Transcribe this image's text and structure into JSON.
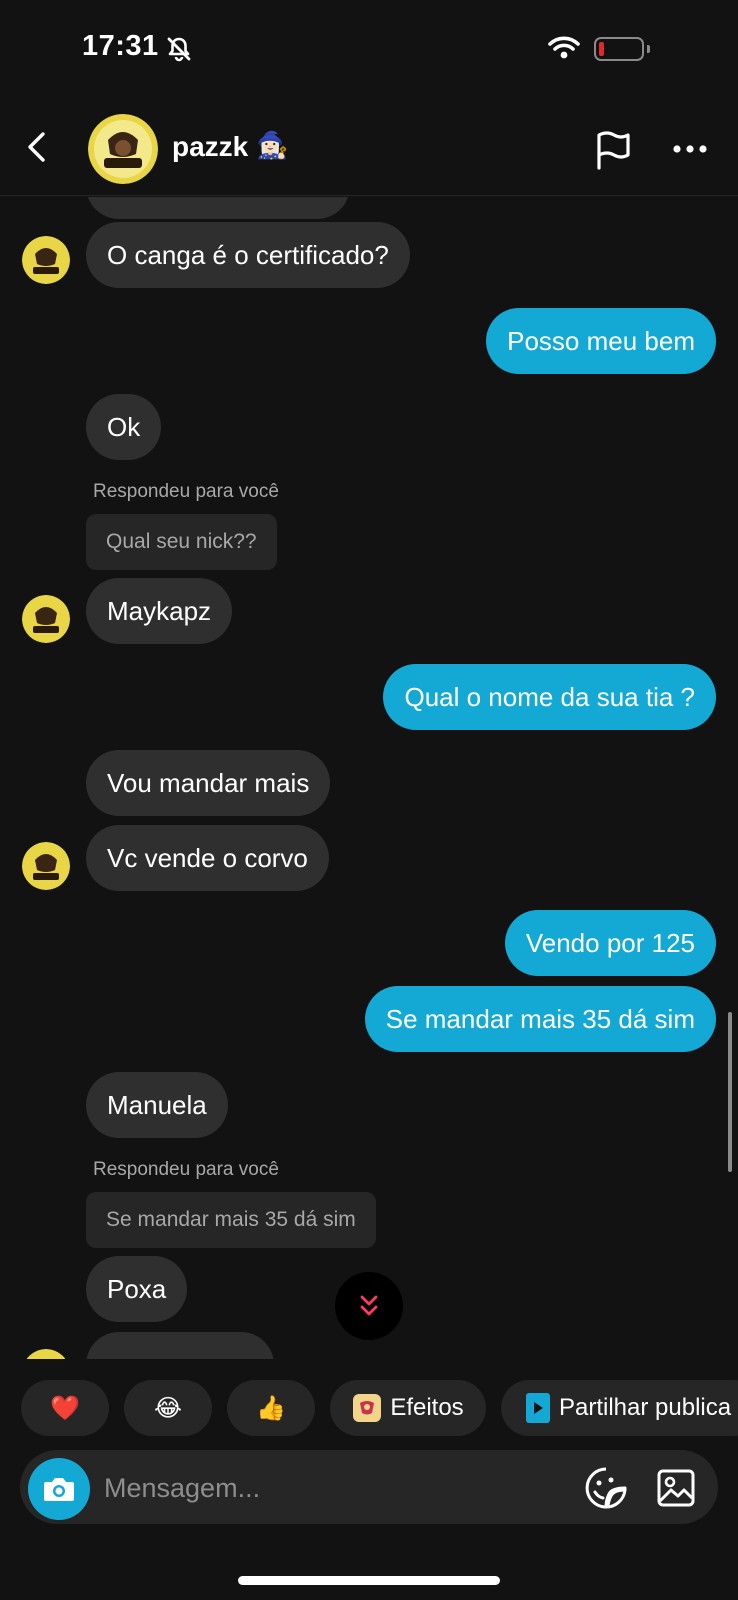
{
  "status_bar": {
    "time": "17:31",
    "battery_color": "#e0292f"
  },
  "header": {
    "contact_name": "pazzk",
    "contact_emoji": "🧙🏻‍♀️"
  },
  "messages": [
    {
      "from": "them",
      "text": "O canga é o certificado?"
    },
    {
      "from": "me",
      "text": "Posso meu bem"
    },
    {
      "from": "them",
      "text": "Ok"
    },
    {
      "from": "them",
      "reply_label": "Respondeu para você",
      "reply_quote": "Qual seu nick??",
      "text": "Maykapz"
    },
    {
      "from": "me",
      "text": "Qual o nome da sua tia ?"
    },
    {
      "from": "them",
      "text": "Vou mandar mais"
    },
    {
      "from": "them",
      "text": "Vc vende o corvo"
    },
    {
      "from": "me",
      "text": "Vendo por 125"
    },
    {
      "from": "me",
      "text": "Se mandar mais 35 dá sim"
    },
    {
      "from": "them",
      "text": "Manuela"
    },
    {
      "from": "them",
      "reply_label": "Respondeu para você",
      "reply_quote": "Se mandar mais 35 dá sim",
      "text": "Poxa"
    }
  ],
  "quick_replies": [
    {
      "emoji": "❤️"
    },
    {
      "emoji": "😂"
    },
    {
      "emoji": "👍"
    },
    {
      "label": "Efeitos"
    },
    {
      "label": "Partilhar publica"
    }
  ],
  "composer": {
    "placeholder": "Mensagem..."
  },
  "colors": {
    "outgoing_bubble": "#14a9d4",
    "incoming_bubble": "#2f2f2f",
    "background": "#121212"
  }
}
